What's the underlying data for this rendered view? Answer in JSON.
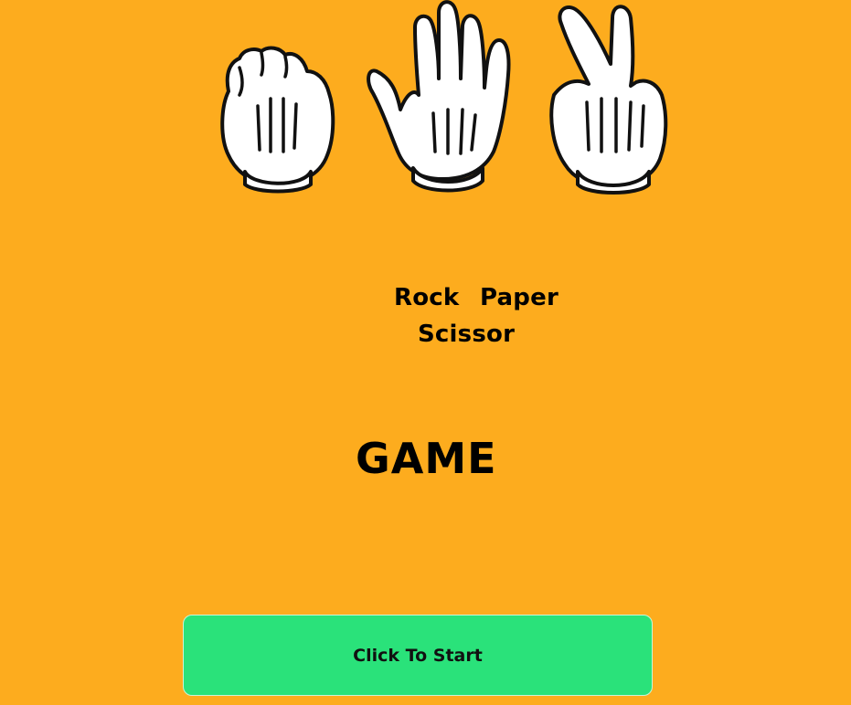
{
  "colors": {
    "background": "#FDAC1E",
    "button": "#2AE27A",
    "glove": "#FFFFFF",
    "outline": "#111111"
  },
  "hands": [
    {
      "icon": "rock-hand-icon",
      "meaning": "rock"
    },
    {
      "icon": "paper-hand-icon",
      "meaning": "paper"
    },
    {
      "icon": "scissor-hand-icon",
      "meaning": "scissor"
    }
  ],
  "title": {
    "word1": "Rock",
    "word2": "Paper",
    "word3": "Scissor"
  },
  "heading": "GAME",
  "start_button": {
    "label": "Click To Start"
  }
}
